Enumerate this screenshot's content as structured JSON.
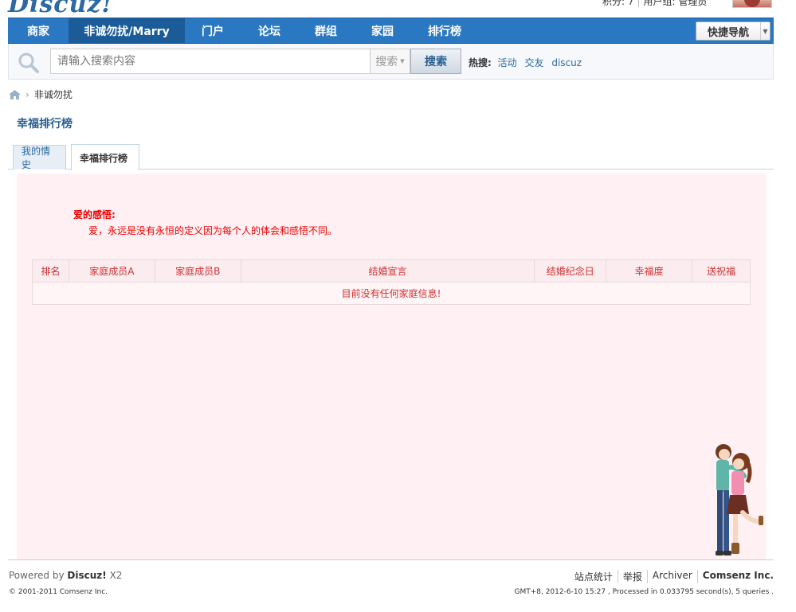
{
  "header": {
    "logo_text": "Discuz!",
    "user_info": {
      "points_label": "积分: 7",
      "group_label": "用户组: 管理员"
    }
  },
  "nav": {
    "items": [
      {
        "label": "商家"
      },
      {
        "label": "非诚勿扰/Marry",
        "active": true
      },
      {
        "label": "门户"
      },
      {
        "label": "论坛"
      },
      {
        "label": "群组"
      },
      {
        "label": "家园"
      },
      {
        "label": "排行榜"
      }
    ],
    "quick_nav_label": "快捷导航"
  },
  "search": {
    "placeholder": "请输入搜索内容",
    "type_label": "搜索",
    "button_label": "搜索",
    "hot_label": "热搜:",
    "hot_links": [
      "活动",
      "交友",
      "discuz"
    ]
  },
  "breadcrumb": {
    "current": "非诚勿扰"
  },
  "page_title": "幸福排行榜",
  "tabs": [
    {
      "label": "我的情史"
    },
    {
      "label": "幸福排行榜",
      "active": true
    }
  ],
  "love": {
    "title": "爱的感悟:",
    "text": "爱，永远是没有永恒的定义因为每个人的体会和感悟不同。"
  },
  "table": {
    "headers": [
      "排名",
      "家庭成员A",
      "家庭成员B",
      "结婚宣言",
      "结婚纪念日",
      "幸福度",
      "送祝福"
    ],
    "empty_message": "目前没有任何家庭信息!"
  },
  "footer": {
    "powered_prefix": "Powered by",
    "powered_brand": "Discuz!",
    "powered_version": "X2",
    "copyright": "© 2001-2011 Comsenz Inc.",
    "links": [
      "站点统计",
      "举报",
      "Archiver",
      "Comsenz Inc."
    ],
    "gmt": "GMT+8, 2012-6-10 15:27 , Processed in 0.033795 second(s), 5 queries ."
  },
  "colors": {
    "nav_bg": "#2b78c2",
    "nav_active": "#1b5b97",
    "content_bg": "#fff0f3",
    "alert_red": "#e00000"
  }
}
